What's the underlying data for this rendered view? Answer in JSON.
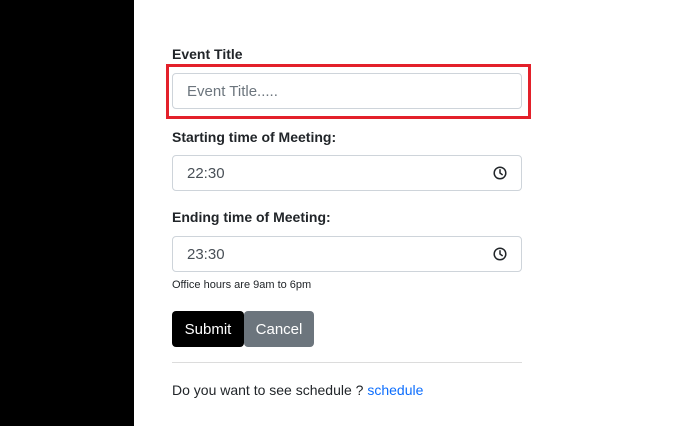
{
  "form": {
    "event_title_label": "Event Title",
    "event_title_placeholder": "Event Title.....",
    "start_label": "Starting time of Meeting:",
    "start_value": "22:30",
    "end_label": "Ending time of Meeting:",
    "end_value": "23:30",
    "help_text": "Office hours are 9am to 6pm",
    "submit_label": "Submit",
    "cancel_label": "Cancel"
  },
  "footer": {
    "prompt": "Do you want to see schedule ? ",
    "link_label": "schedule"
  },
  "colors": {
    "sidebar": "#000000",
    "highlight": "#e3202a",
    "submit_bg": "#000000",
    "cancel_bg": "#6c757d",
    "link": "#0d6efd"
  },
  "icons": [
    "clock-icon"
  ]
}
